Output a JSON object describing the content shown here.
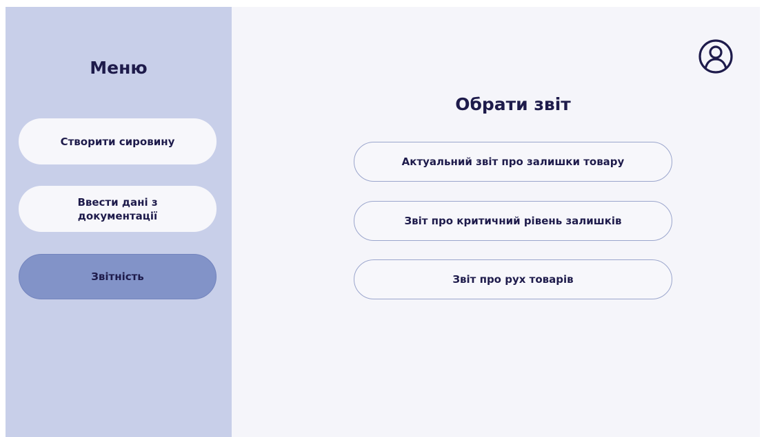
{
  "sidebar": {
    "title": "Меню",
    "items": [
      {
        "label": "Створити сировину",
        "active": false
      },
      {
        "label": "Ввести дані з\nдокументації",
        "active": false
      },
      {
        "label": "Звітність",
        "active": true
      }
    ]
  },
  "header": {
    "avatar_icon": "user-circle-icon"
  },
  "main": {
    "title": "Обрати звіт",
    "reports": [
      {
        "label": "Актуальний звіт про залишки товару"
      },
      {
        "label": "Звіт про критичний рівень залишків"
      },
      {
        "label": "Звіт про рух товарів"
      }
    ]
  },
  "colors": {
    "sidebar_bg": "#c8cfe9",
    "active_item": "#8293c8",
    "text": "#1e1b4b",
    "content_bg": "#f5f5fa"
  }
}
